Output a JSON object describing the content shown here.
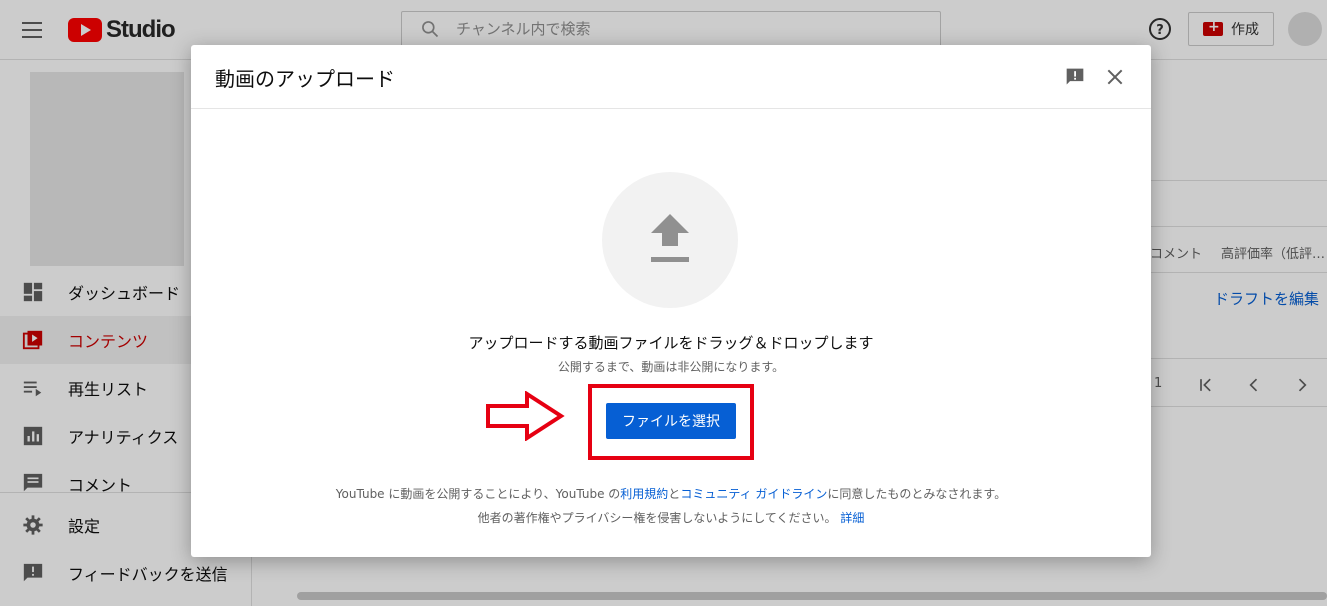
{
  "topbar": {
    "logo_text": "Studio",
    "search_placeholder": "チャンネル内で検索",
    "create_label": "作成"
  },
  "sidebar": {
    "items": [
      {
        "label": "ダッシュボード",
        "icon": "dashboard-icon"
      },
      {
        "label": "コンテンツ",
        "icon": "content-icon",
        "active": true
      },
      {
        "label": "再生リスト",
        "icon": "playlist-icon"
      },
      {
        "label": "アナリティクス",
        "icon": "analytics-icon"
      },
      {
        "label": "コメント",
        "icon": "comment-icon"
      }
    ],
    "bottom_items": [
      {
        "label": "設定",
        "icon": "settings-icon"
      },
      {
        "label": "フィードバックを送信",
        "icon": "feedback-icon"
      }
    ]
  },
  "content": {
    "col_comments": "コメント",
    "col_likes": "高評価率（低評…",
    "draft_link": "ドラフトを編集",
    "page_num": "1"
  },
  "dialog": {
    "title": "動画のアップロード",
    "main_text": "アップロードする動画ファイルをドラッグ＆ドロップします",
    "sub_text": "公開するまで、動画は非公開になります。",
    "select_button": "ファイルを選択",
    "legal_line1_pre": "YouTube に動画を公開することにより、YouTube の",
    "legal_terms_link": "利用規約",
    "legal_and": "と",
    "legal_guidelines_link": "コミュニティ ガイドライン",
    "legal_line1_post": "に同意したものとみなされます。",
    "legal_line2": "他者の著作権やプライバシー権を侵害しないようにしてください。",
    "legal_details_link": "詳細"
  },
  "colors": {
    "accent": "#065fd4",
    "brand": "#ff0000",
    "highlight": "#e60012"
  }
}
